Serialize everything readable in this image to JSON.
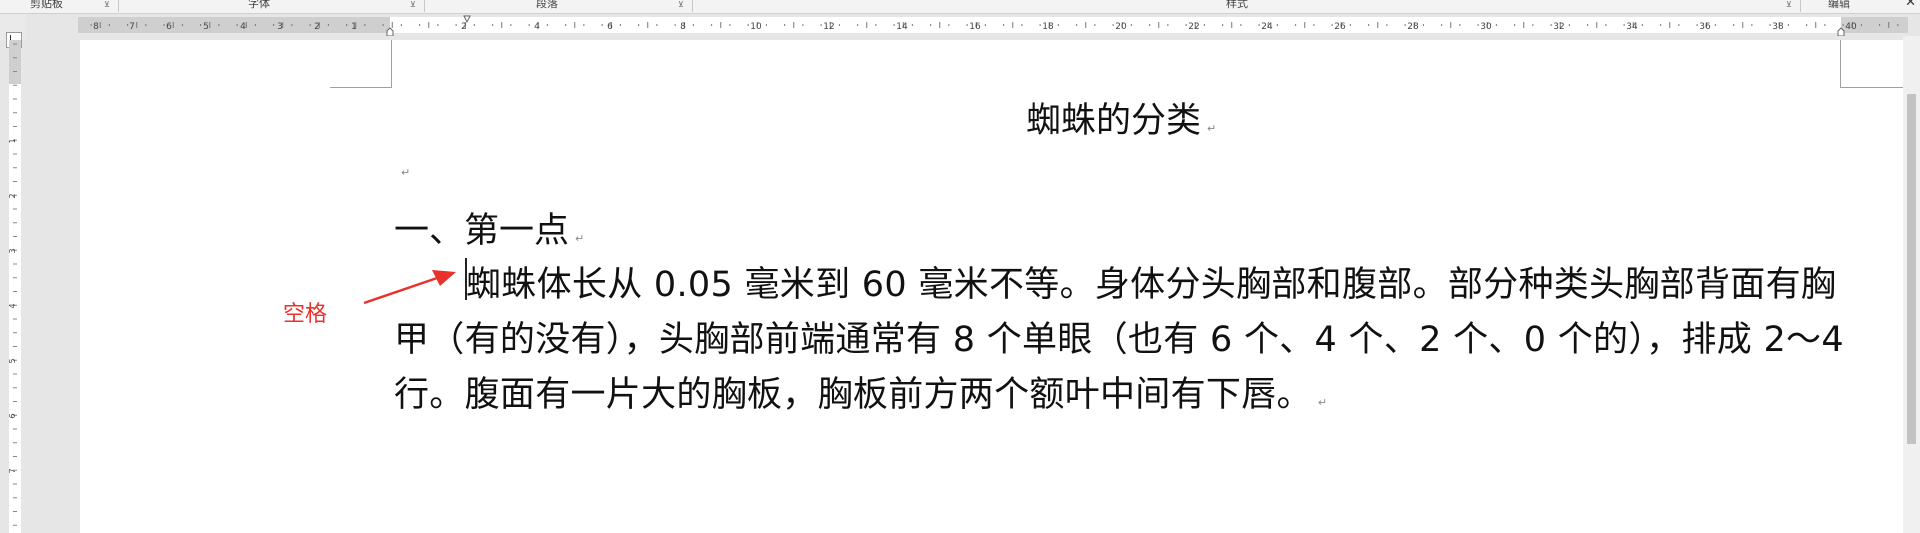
{
  "ribbon": {
    "groups": [
      {
        "label": "剪贴板"
      },
      {
        "label": "字体"
      },
      {
        "label": "段落"
      },
      {
        "label": "样式"
      },
      {
        "label": "编辑"
      }
    ],
    "launcher_glyph": "⊻",
    "close_glyph": "✕"
  },
  "ruler": {
    "left_numbers": [
      "8",
      "7",
      "6",
      "5",
      "4",
      "3",
      "2",
      "1"
    ],
    "main_numbers": [
      "2",
      "4",
      "6",
      "8",
      "10",
      "12",
      "14",
      "16",
      "18",
      "20",
      "22",
      "24",
      "26",
      "28",
      "30",
      "32",
      "34",
      "36",
      "38",
      "40"
    ],
    "vertical_numbers": [
      "1",
      "2",
      "3",
      "4",
      "5",
      "6",
      "7"
    ]
  },
  "document": {
    "title": "蜘蛛的分类",
    "heading": "一、第一点",
    "paragraph_lines": [
      "蜘蛛体长从 0.05 毫米到 60 毫米不等。身体分头胸部和腹部。部分种类头胸部背面有胸",
      "甲（有的没有），头胸部前端通常有 8 个单眼（也有 6 个、4 个、2 个、0 个的），排成 2～4",
      "行。腹面有一片大的胸板，胸板前方两个额叶中间有下唇。"
    ],
    "paragraph_mark": "↵"
  },
  "annotation": {
    "label": "空格",
    "color": "#e8322b"
  }
}
